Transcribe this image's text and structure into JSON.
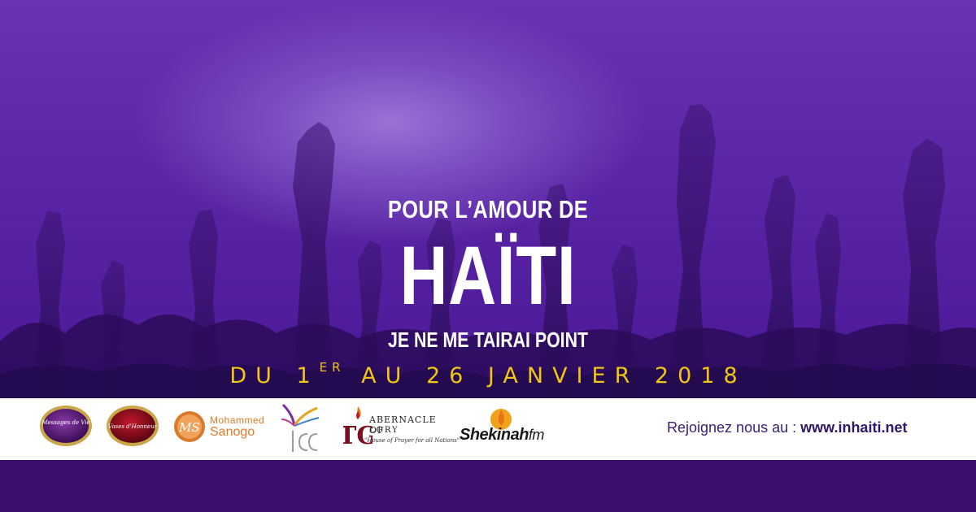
{
  "headline": {
    "line1": "POUR L’AMOUR DE",
    "line2": "HAÏTI",
    "line3": "JE NE ME TAIRAI POINT"
  },
  "dates": {
    "prefix": "DU 1",
    "superscript": "ER",
    "suffix": "AU 26 JANVIER 2018"
  },
  "logos": {
    "messages_de_vie": "Messages de Vie",
    "vases_honneur": "Vases d'Honneur",
    "ms_initials": "MS",
    "mohammed": "Mohammed",
    "sanogo": "Sanogo",
    "icc": "ICC",
    "tabernacle_initials": "TG",
    "tabernacle_name": "ABERNACLE OF",
    "tabernacle_glory": "LORY",
    "tabernacle_tagline": "\"House of Prayer for all Nations\"",
    "shekinah": "Shekinah",
    "shekinah_fm": "fm"
  },
  "join": {
    "label": "Rejoignez nous au : ",
    "url": "www.inhaiti.net"
  },
  "colors": {
    "purple_bg": "#5a25a6",
    "footer_purple": "#3a0f6e",
    "date_gold": "#f2c417",
    "text_white": "#ffffff"
  }
}
